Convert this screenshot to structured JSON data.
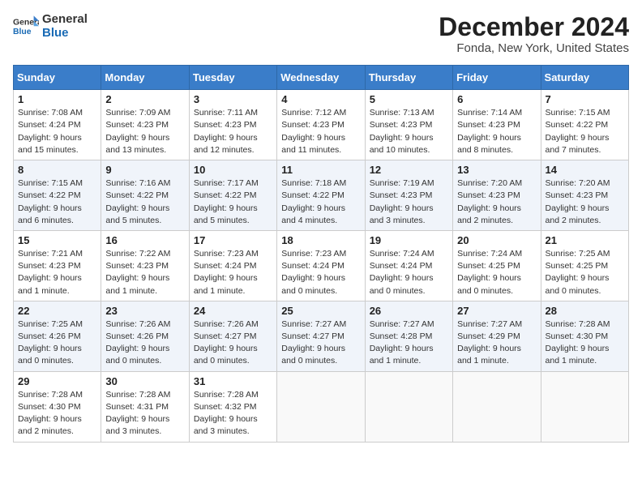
{
  "logo": {
    "line1": "General",
    "line2": "Blue"
  },
  "title": "December 2024",
  "location": "Fonda, New York, United States",
  "days_header": [
    "Sunday",
    "Monday",
    "Tuesday",
    "Wednesday",
    "Thursday",
    "Friday",
    "Saturday"
  ],
  "weeks": [
    [
      {
        "day": "1",
        "info": "Sunrise: 7:08 AM\nSunset: 4:24 PM\nDaylight: 9 hours\nand 15 minutes."
      },
      {
        "day": "2",
        "info": "Sunrise: 7:09 AM\nSunset: 4:23 PM\nDaylight: 9 hours\nand 13 minutes."
      },
      {
        "day": "3",
        "info": "Sunrise: 7:11 AM\nSunset: 4:23 PM\nDaylight: 9 hours\nand 12 minutes."
      },
      {
        "day": "4",
        "info": "Sunrise: 7:12 AM\nSunset: 4:23 PM\nDaylight: 9 hours\nand 11 minutes."
      },
      {
        "day": "5",
        "info": "Sunrise: 7:13 AM\nSunset: 4:23 PM\nDaylight: 9 hours\nand 10 minutes."
      },
      {
        "day": "6",
        "info": "Sunrise: 7:14 AM\nSunset: 4:23 PM\nDaylight: 9 hours\nand 8 minutes."
      },
      {
        "day": "7",
        "info": "Sunrise: 7:15 AM\nSunset: 4:22 PM\nDaylight: 9 hours\nand 7 minutes."
      }
    ],
    [
      {
        "day": "8",
        "info": "Sunrise: 7:15 AM\nSunset: 4:22 PM\nDaylight: 9 hours\nand 6 minutes."
      },
      {
        "day": "9",
        "info": "Sunrise: 7:16 AM\nSunset: 4:22 PM\nDaylight: 9 hours\nand 5 minutes."
      },
      {
        "day": "10",
        "info": "Sunrise: 7:17 AM\nSunset: 4:22 PM\nDaylight: 9 hours\nand 5 minutes."
      },
      {
        "day": "11",
        "info": "Sunrise: 7:18 AM\nSunset: 4:22 PM\nDaylight: 9 hours\nand 4 minutes."
      },
      {
        "day": "12",
        "info": "Sunrise: 7:19 AM\nSunset: 4:23 PM\nDaylight: 9 hours\nand 3 minutes."
      },
      {
        "day": "13",
        "info": "Sunrise: 7:20 AM\nSunset: 4:23 PM\nDaylight: 9 hours\nand 2 minutes."
      },
      {
        "day": "14",
        "info": "Sunrise: 7:20 AM\nSunset: 4:23 PM\nDaylight: 9 hours\nand 2 minutes."
      }
    ],
    [
      {
        "day": "15",
        "info": "Sunrise: 7:21 AM\nSunset: 4:23 PM\nDaylight: 9 hours\nand 1 minute."
      },
      {
        "day": "16",
        "info": "Sunrise: 7:22 AM\nSunset: 4:23 PM\nDaylight: 9 hours\nand 1 minute."
      },
      {
        "day": "17",
        "info": "Sunrise: 7:23 AM\nSunset: 4:24 PM\nDaylight: 9 hours\nand 1 minute."
      },
      {
        "day": "18",
        "info": "Sunrise: 7:23 AM\nSunset: 4:24 PM\nDaylight: 9 hours\nand 0 minutes."
      },
      {
        "day": "19",
        "info": "Sunrise: 7:24 AM\nSunset: 4:24 PM\nDaylight: 9 hours\nand 0 minutes."
      },
      {
        "day": "20",
        "info": "Sunrise: 7:24 AM\nSunset: 4:25 PM\nDaylight: 9 hours\nand 0 minutes."
      },
      {
        "day": "21",
        "info": "Sunrise: 7:25 AM\nSunset: 4:25 PM\nDaylight: 9 hours\nand 0 minutes."
      }
    ],
    [
      {
        "day": "22",
        "info": "Sunrise: 7:25 AM\nSunset: 4:26 PM\nDaylight: 9 hours\nand 0 minutes."
      },
      {
        "day": "23",
        "info": "Sunrise: 7:26 AM\nSunset: 4:26 PM\nDaylight: 9 hours\nand 0 minutes."
      },
      {
        "day": "24",
        "info": "Sunrise: 7:26 AM\nSunset: 4:27 PM\nDaylight: 9 hours\nand 0 minutes."
      },
      {
        "day": "25",
        "info": "Sunrise: 7:27 AM\nSunset: 4:27 PM\nDaylight: 9 hours\nand 0 minutes."
      },
      {
        "day": "26",
        "info": "Sunrise: 7:27 AM\nSunset: 4:28 PM\nDaylight: 9 hours\nand 1 minute."
      },
      {
        "day": "27",
        "info": "Sunrise: 7:27 AM\nSunset: 4:29 PM\nDaylight: 9 hours\nand 1 minute."
      },
      {
        "day": "28",
        "info": "Sunrise: 7:28 AM\nSunset: 4:30 PM\nDaylight: 9 hours\nand 1 minute."
      }
    ],
    [
      {
        "day": "29",
        "info": "Sunrise: 7:28 AM\nSunset: 4:30 PM\nDaylight: 9 hours\nand 2 minutes."
      },
      {
        "day": "30",
        "info": "Sunrise: 7:28 AM\nSunset: 4:31 PM\nDaylight: 9 hours\nand 3 minutes."
      },
      {
        "day": "31",
        "info": "Sunrise: 7:28 AM\nSunset: 4:32 PM\nDaylight: 9 hours\nand 3 minutes."
      },
      null,
      null,
      null,
      null
    ]
  ]
}
